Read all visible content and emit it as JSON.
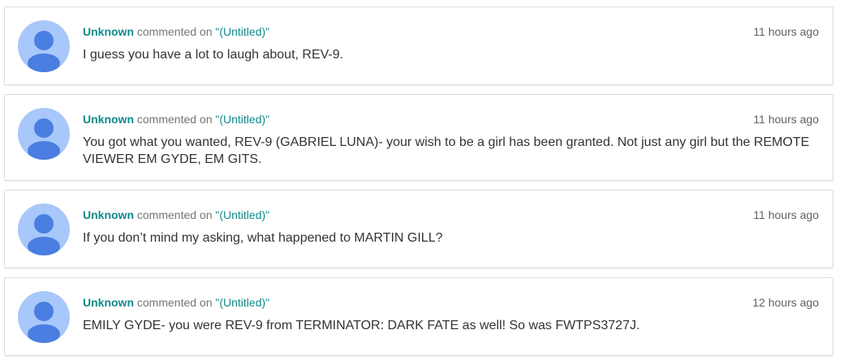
{
  "comments": [
    {
      "author": "Unknown",
      "action": "commented on",
      "post_title": "\"(Untitled)\"",
      "time": "11 hours ago",
      "text": "I guess you have a lot to laugh about, REV-9."
    },
    {
      "author": "Unknown",
      "action": "commented on",
      "post_title": "\"(Untitled)\"",
      "time": "11 hours ago",
      "text": "You got what you wanted, REV-9 (GABRIEL LUNA)- your wish to be a girl has been granted. Not just any girl but the REMOTE VIEWER EM GYDE, EM GITS."
    },
    {
      "author": "Unknown",
      "action": "commented on",
      "post_title": "\"(Untitled)\"",
      "time": "11 hours ago",
      "text": "If you don’t mind my asking, what happened to MARTIN GILL?"
    },
    {
      "author": "Unknown",
      "action": "commented on",
      "post_title": "\"(Untitled)\"",
      "time": "12 hours ago",
      "text": "EMILY GYDE- you were REV-9 from TERMINATOR: DARK FATE as well! So was FWTPS3727J."
    }
  ],
  "colors": {
    "link": "#128a8a",
    "avatar_bg": "#a8c7fa",
    "avatar_figure": "#4a7ee0"
  },
  "icons": {
    "avatar": "default-user-avatar-icon"
  }
}
